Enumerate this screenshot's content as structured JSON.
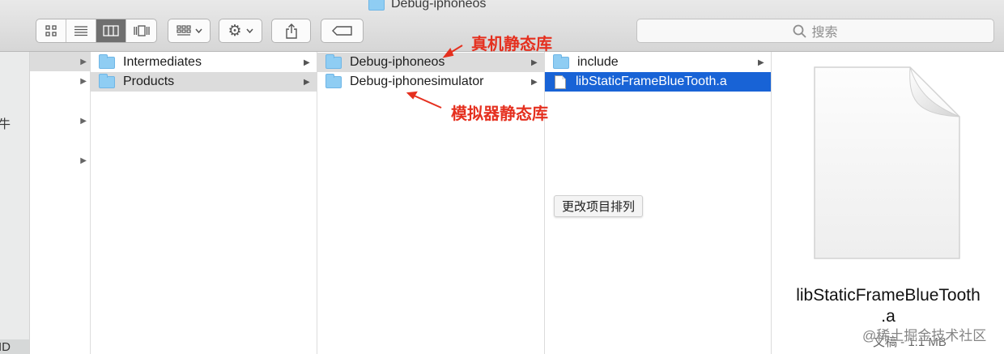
{
  "window": {
    "title": "Debug-iphoneos"
  },
  "toolbar": {
    "search_placeholder": "搜索",
    "view_icons": [
      "icon-view-icon",
      "list-view-icon",
      "column-view-icon",
      "gallery-view-icon"
    ],
    "active_view": "column-view-icon"
  },
  "sidebar": {
    "fragments": [
      "牛",
      "ID"
    ]
  },
  "columns": {
    "col2": [
      {
        "label": "Intermediates",
        "kind": "folder",
        "has_children": true,
        "selected": false
      },
      {
        "label": "Products",
        "kind": "folder",
        "has_children": true,
        "selected": "gray"
      }
    ],
    "col3": [
      {
        "label": "Debug-iphoneos",
        "kind": "folder",
        "has_children": true,
        "selected": "gray"
      },
      {
        "label": "Debug-iphonesimulator",
        "kind": "folder",
        "has_children": true,
        "selected": false
      }
    ],
    "col4": [
      {
        "label": "include",
        "kind": "folder",
        "has_children": true,
        "selected": false
      },
      {
        "label": "libStaticFrameBlueTooth.a",
        "kind": "file",
        "has_children": false,
        "selected": "blue"
      }
    ]
  },
  "context_button": {
    "label": "更改项目排列"
  },
  "preview": {
    "filename_line1": "libStaticFrameBlueTooth",
    "filename_line2": ".a",
    "info": "文稿 - 1.1 MB"
  },
  "annotations": {
    "device": "真机静态库",
    "simulator": "模拟器静态库"
  },
  "watermark": "@稀土掘金技术社区",
  "colors": {
    "selection_blue": "#1863d6",
    "selection_gray": "#dcdcdc",
    "annotation_red": "#e5301f",
    "folder_blue": "#8fcdf3"
  }
}
